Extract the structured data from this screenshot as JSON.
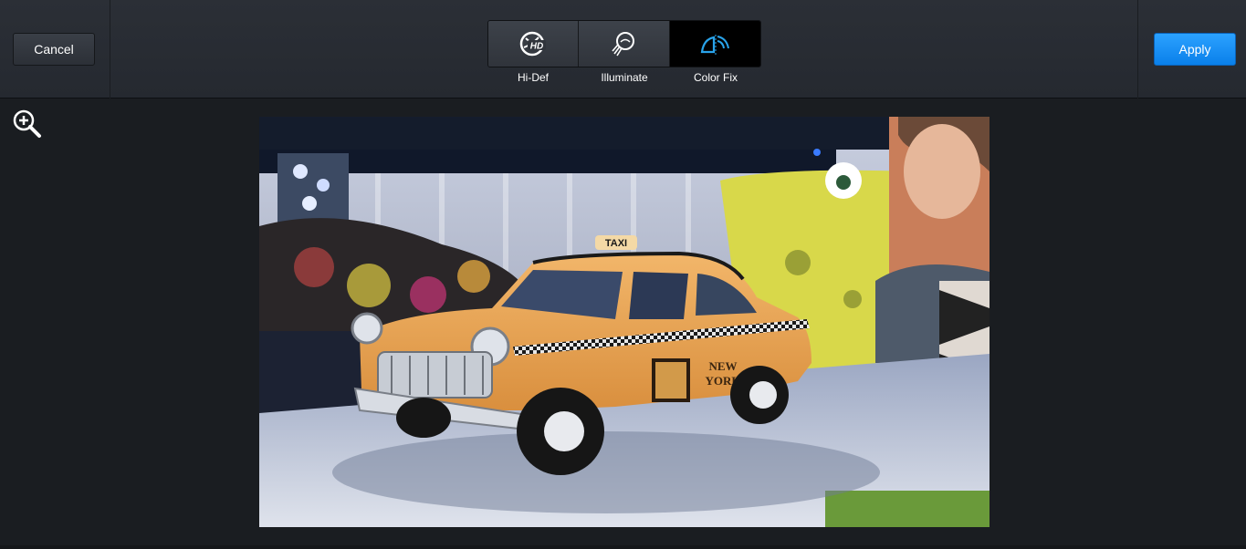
{
  "toolbar": {
    "cancel_label": "Cancel",
    "apply_label": "Apply",
    "tools": [
      {
        "label": "Hi-Def",
        "icon": "hi-def-icon",
        "active": false
      },
      {
        "label": "Illuminate",
        "icon": "illuminate-icon",
        "active": false
      },
      {
        "label": "Color Fix",
        "icon": "color-fix-icon",
        "active": true
      }
    ]
  },
  "canvas": {
    "zoom_icon": "zoom-in-icon",
    "photo_text": {
      "roof_sign": "TAXI",
      "door_line1": "NEW",
      "door_line2": "YORK"
    }
  },
  "colors": {
    "accent": "#0a80ea",
    "active_tool_icon": "#29a3ea",
    "background": "#1a1d21"
  }
}
